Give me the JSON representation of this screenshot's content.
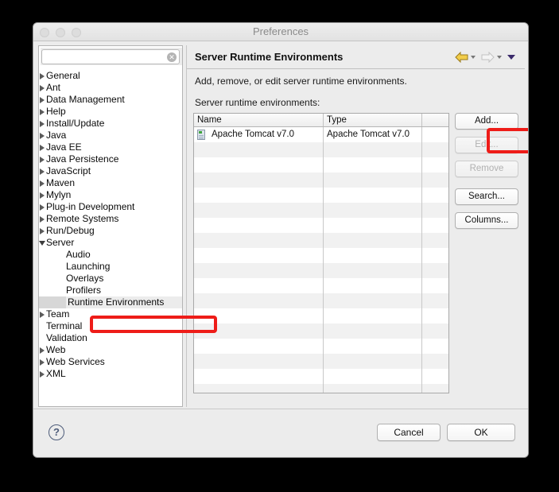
{
  "window": {
    "title": "Preferences",
    "traffic_lights": [
      "close",
      "minimize",
      "maximize"
    ]
  },
  "sidebar": {
    "search": {
      "value": "",
      "placeholder": "",
      "clear_icon": "clear-icon",
      "clear_glyph": "✕"
    },
    "items": [
      {
        "label": "General",
        "level": 0,
        "expandable": true,
        "expanded": false,
        "selected": false
      },
      {
        "label": "Ant",
        "level": 0,
        "expandable": true,
        "expanded": false,
        "selected": false
      },
      {
        "label": "Data Management",
        "level": 0,
        "expandable": true,
        "expanded": false,
        "selected": false
      },
      {
        "label": "Help",
        "level": 0,
        "expandable": true,
        "expanded": false,
        "selected": false
      },
      {
        "label": "Install/Update",
        "level": 0,
        "expandable": true,
        "expanded": false,
        "selected": false
      },
      {
        "label": "Java",
        "level": 0,
        "expandable": true,
        "expanded": false,
        "selected": false
      },
      {
        "label": "Java EE",
        "level": 0,
        "expandable": true,
        "expanded": false,
        "selected": false
      },
      {
        "label": "Java Persistence",
        "level": 0,
        "expandable": true,
        "expanded": false,
        "selected": false
      },
      {
        "label": "JavaScript",
        "level": 0,
        "expandable": true,
        "expanded": false,
        "selected": false
      },
      {
        "label": "Maven",
        "level": 0,
        "expandable": true,
        "expanded": false,
        "selected": false
      },
      {
        "label": "Mylyn",
        "level": 0,
        "expandable": true,
        "expanded": false,
        "selected": false
      },
      {
        "label": "Plug-in Development",
        "level": 0,
        "expandable": true,
        "expanded": false,
        "selected": false
      },
      {
        "label": "Remote Systems",
        "level": 0,
        "expandable": true,
        "expanded": false,
        "selected": false
      },
      {
        "label": "Run/Debug",
        "level": 0,
        "expandable": true,
        "expanded": false,
        "selected": false
      },
      {
        "label": "Server",
        "level": 0,
        "expandable": true,
        "expanded": true,
        "selected": false
      },
      {
        "label": "Audio",
        "level": 1,
        "expandable": false,
        "expanded": false,
        "selected": false
      },
      {
        "label": "Launching",
        "level": 1,
        "expandable": false,
        "expanded": false,
        "selected": false
      },
      {
        "label": "Overlays",
        "level": 1,
        "expandable": false,
        "expanded": false,
        "selected": false
      },
      {
        "label": "Profilers",
        "level": 1,
        "expandable": false,
        "expanded": false,
        "selected": false
      },
      {
        "label": "Runtime Environments",
        "level": 1,
        "expandable": false,
        "expanded": false,
        "selected": true
      },
      {
        "label": "Team",
        "level": 0,
        "expandable": true,
        "expanded": false,
        "selected": false
      },
      {
        "label": "Terminal",
        "level": 0,
        "expandable": false,
        "expanded": false,
        "selected": false
      },
      {
        "label": "Validation",
        "level": 0,
        "expandable": false,
        "expanded": false,
        "selected": false
      },
      {
        "label": "Web",
        "level": 0,
        "expandable": true,
        "expanded": false,
        "selected": false
      },
      {
        "label": "Web Services",
        "level": 0,
        "expandable": true,
        "expanded": false,
        "selected": false
      },
      {
        "label": "XML",
        "level": 0,
        "expandable": true,
        "expanded": false,
        "selected": false
      }
    ]
  },
  "panel": {
    "title": "Server Runtime Environments",
    "description": "Add, remove, or edit server runtime environments.",
    "list_label": "Server runtime environments:",
    "nav": {
      "back_icon": "back-arrow-icon",
      "back_menu_icon": "chevron-down-icon",
      "forward_icon": "forward-arrow-icon",
      "forward_menu_icon": "chevron-down-icon",
      "menu_icon": "chevron-down-icon",
      "back_color": "#e8b923",
      "forward_color": "#cfcfcf",
      "menu_color": "#3b2a6b"
    },
    "table": {
      "columns": [
        "Name",
        "Type",
        ""
      ],
      "rows": [
        {
          "name": "Apache Tomcat v7.0",
          "type": "Apache Tomcat v7.0",
          "extra": "",
          "icon": "server-icon"
        }
      ],
      "empty_row_count": 17
    },
    "buttons": [
      {
        "label": "Add...",
        "enabled": true,
        "name": "add-button"
      },
      {
        "label": "Edit...",
        "enabled": false,
        "name": "edit-button"
      },
      {
        "label": "Remove",
        "enabled": false,
        "name": "remove-button"
      },
      {
        "label": "Search...",
        "enabled": true,
        "name": "search-button"
      },
      {
        "label": "Columns...",
        "enabled": true,
        "name": "columns-button"
      }
    ]
  },
  "footer": {
    "help_glyph": "?",
    "help_icon": "help-icon",
    "cancel_label": "Cancel",
    "ok_label": "OK"
  },
  "annotations": {
    "color": "#ee1c18",
    "boxes": [
      "runtime-environments-tree-item",
      "add-button"
    ]
  }
}
